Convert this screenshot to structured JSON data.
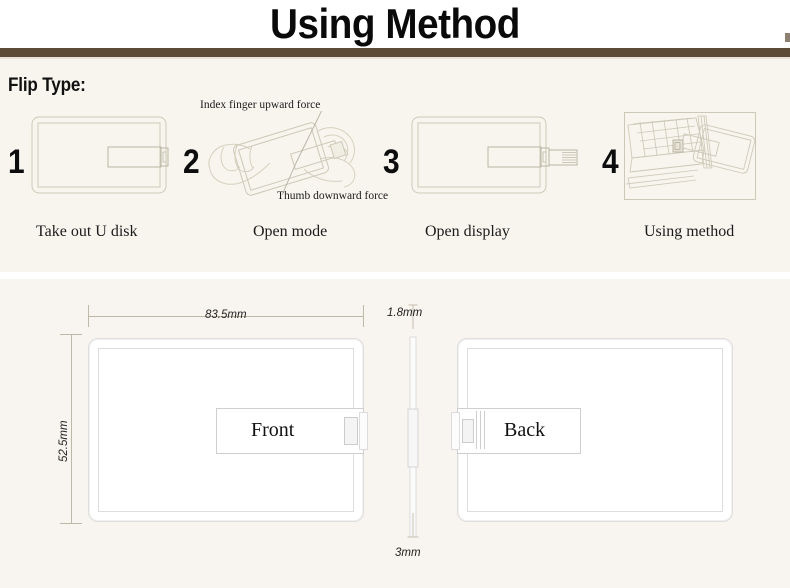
{
  "header": {
    "title": "Using Method",
    "rule_color": "#5b4b37"
  },
  "steps_panel": {
    "section_label": "Flip Type:",
    "background": "#f7f5ee",
    "steps": [
      {
        "number": "1",
        "caption": "Take out U disk",
        "illustration": "card-usb-closed-icon"
      },
      {
        "number": "2",
        "caption": "Open mode",
        "illustration": "hand-flipping-card-icon"
      },
      {
        "number": "3",
        "caption": "Open display",
        "illustration": "card-usb-extended-icon"
      },
      {
        "number": "4",
        "caption": "Using method",
        "illustration": "laptop-with-card-usb-icon"
      }
    ],
    "annotations": [
      {
        "text": "Index finger upward force"
      },
      {
        "text": "Thumb downward force"
      }
    ]
  },
  "dimensions_panel": {
    "background": "#f8f4ef",
    "width_label": "83.5mm",
    "height_label": "52.5mm",
    "thickness_top_label": "1.8mm",
    "thickness_bottom_label": "3mm",
    "front_label": "Front",
    "back_label": "Back"
  }
}
